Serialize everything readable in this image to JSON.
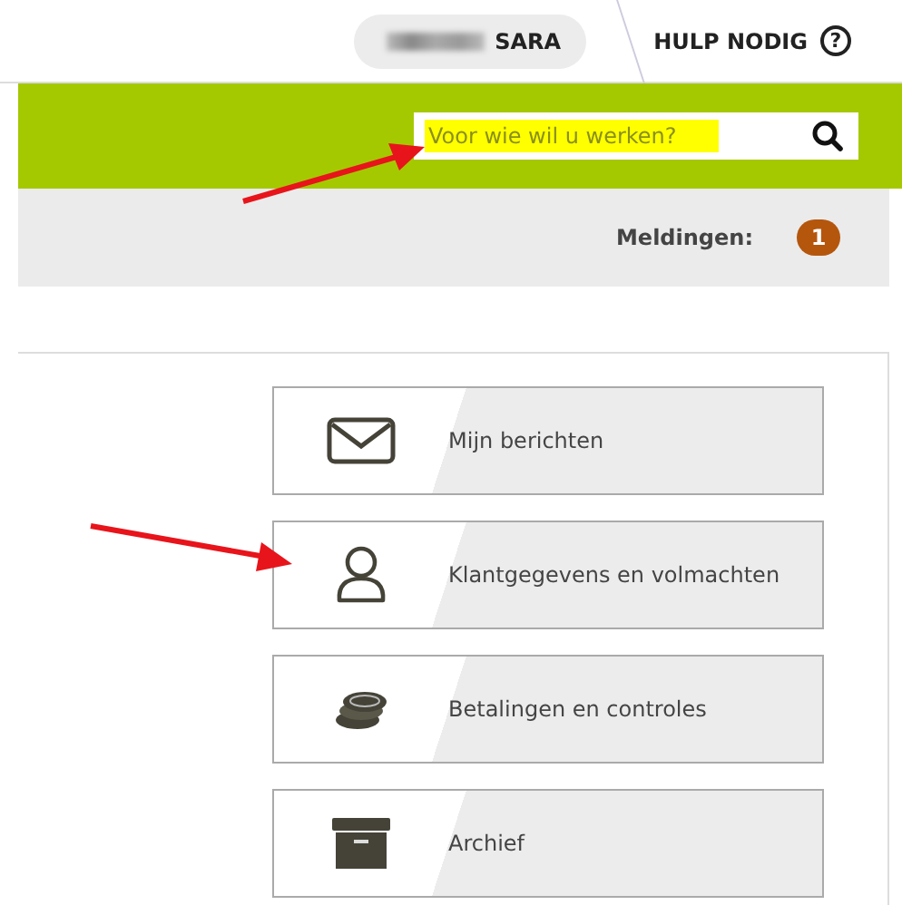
{
  "header": {
    "user_name": "SARA",
    "help": "HULP NODIG",
    "help_icon": "?"
  },
  "search": {
    "placeholder": "Voor wie wil u werken?"
  },
  "notifications": {
    "label": "Meldingen:",
    "count": "1"
  },
  "menu": [
    {
      "kind": "mail",
      "label": "Mijn berichten"
    },
    {
      "kind": "person",
      "label": "Klantgegevens en volmachten"
    },
    {
      "kind": "coins",
      "label": "Betalingen en controles"
    },
    {
      "kind": "archive",
      "label": "Archief"
    }
  ]
}
